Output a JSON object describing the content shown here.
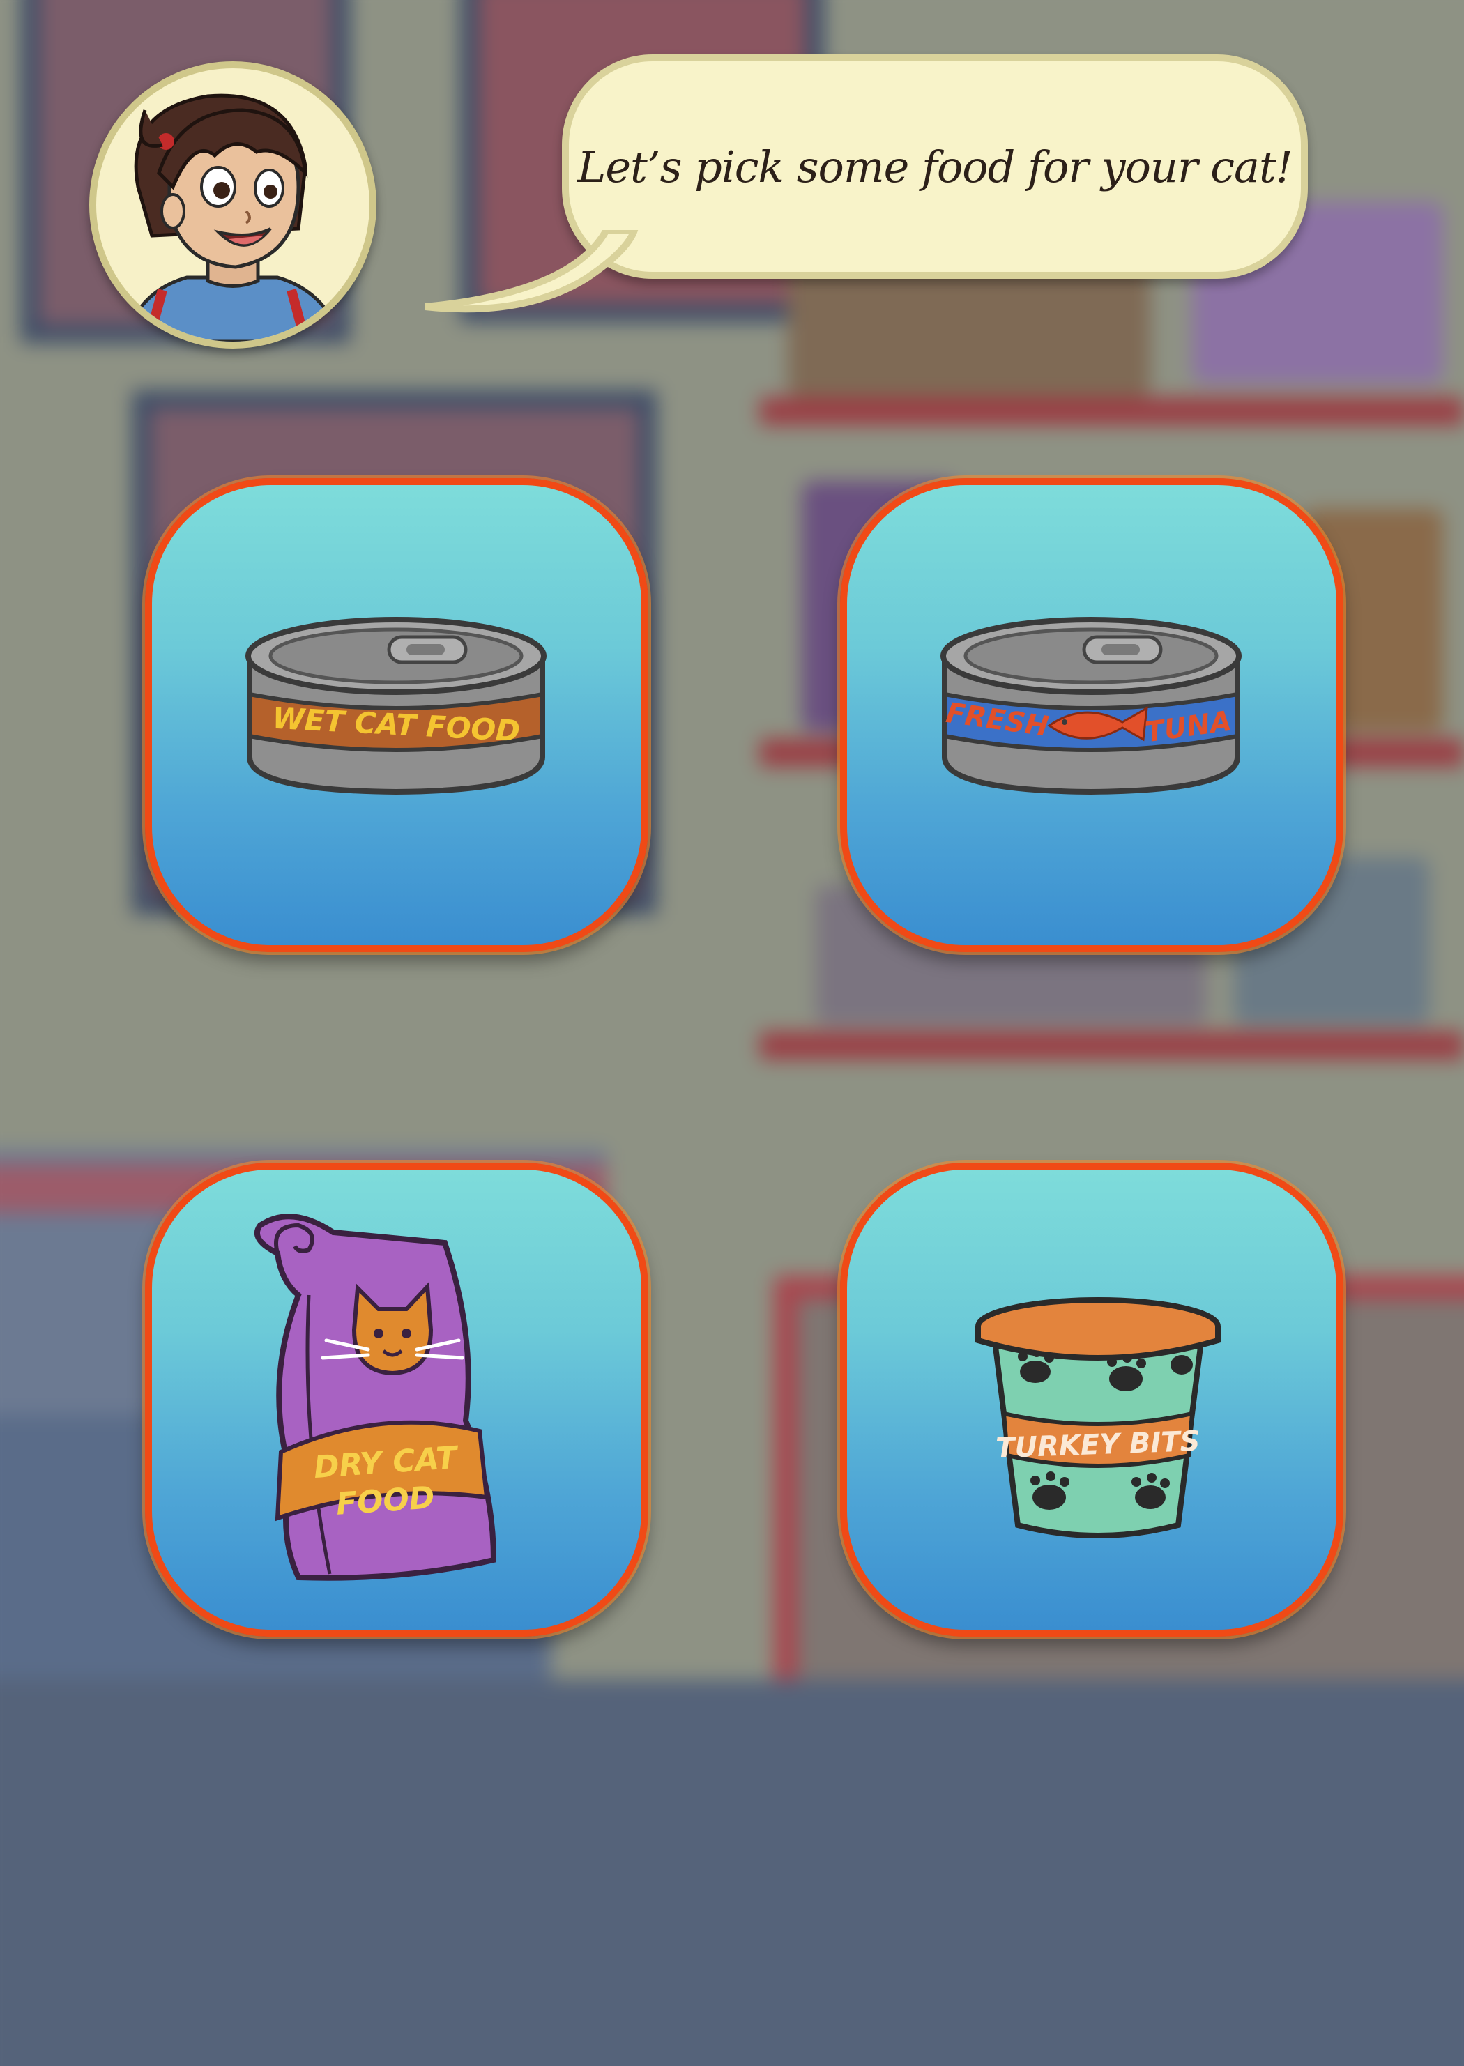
{
  "dialogue": {
    "speaker": "shopkeeper-girl",
    "text": "Let’s pick some food for your cat!"
  },
  "food_options": [
    {
      "id": "wet",
      "label": "WET CAT FOOD",
      "kind": "can",
      "band_color": "#b5612b",
      "text_color": "#f4c431"
    },
    {
      "id": "tuna",
      "label_1": "FRESH",
      "label_2": "TUNA",
      "kind": "can",
      "band_color": "#3b71c8",
      "text_color": "#e2502a"
    },
    {
      "id": "dry",
      "label_1": "DRY CAT",
      "label_2": "FOOD",
      "kind": "bag",
      "bag_color": "#a862c2",
      "band_color": "#e08a2e",
      "text_color": "#f7d04a"
    },
    {
      "id": "turkey",
      "label": "TURKEY BITS",
      "kind": "cup",
      "cup_color": "#7ed0b0",
      "band_color": "#e3843d",
      "text_color": "#fbe9d6"
    }
  ],
  "colors": {
    "button_top": "#7edcda",
    "button_bottom": "#3a8ed0",
    "button_border": "#f04a16",
    "bubble_fill": "#f8f3c9"
  }
}
